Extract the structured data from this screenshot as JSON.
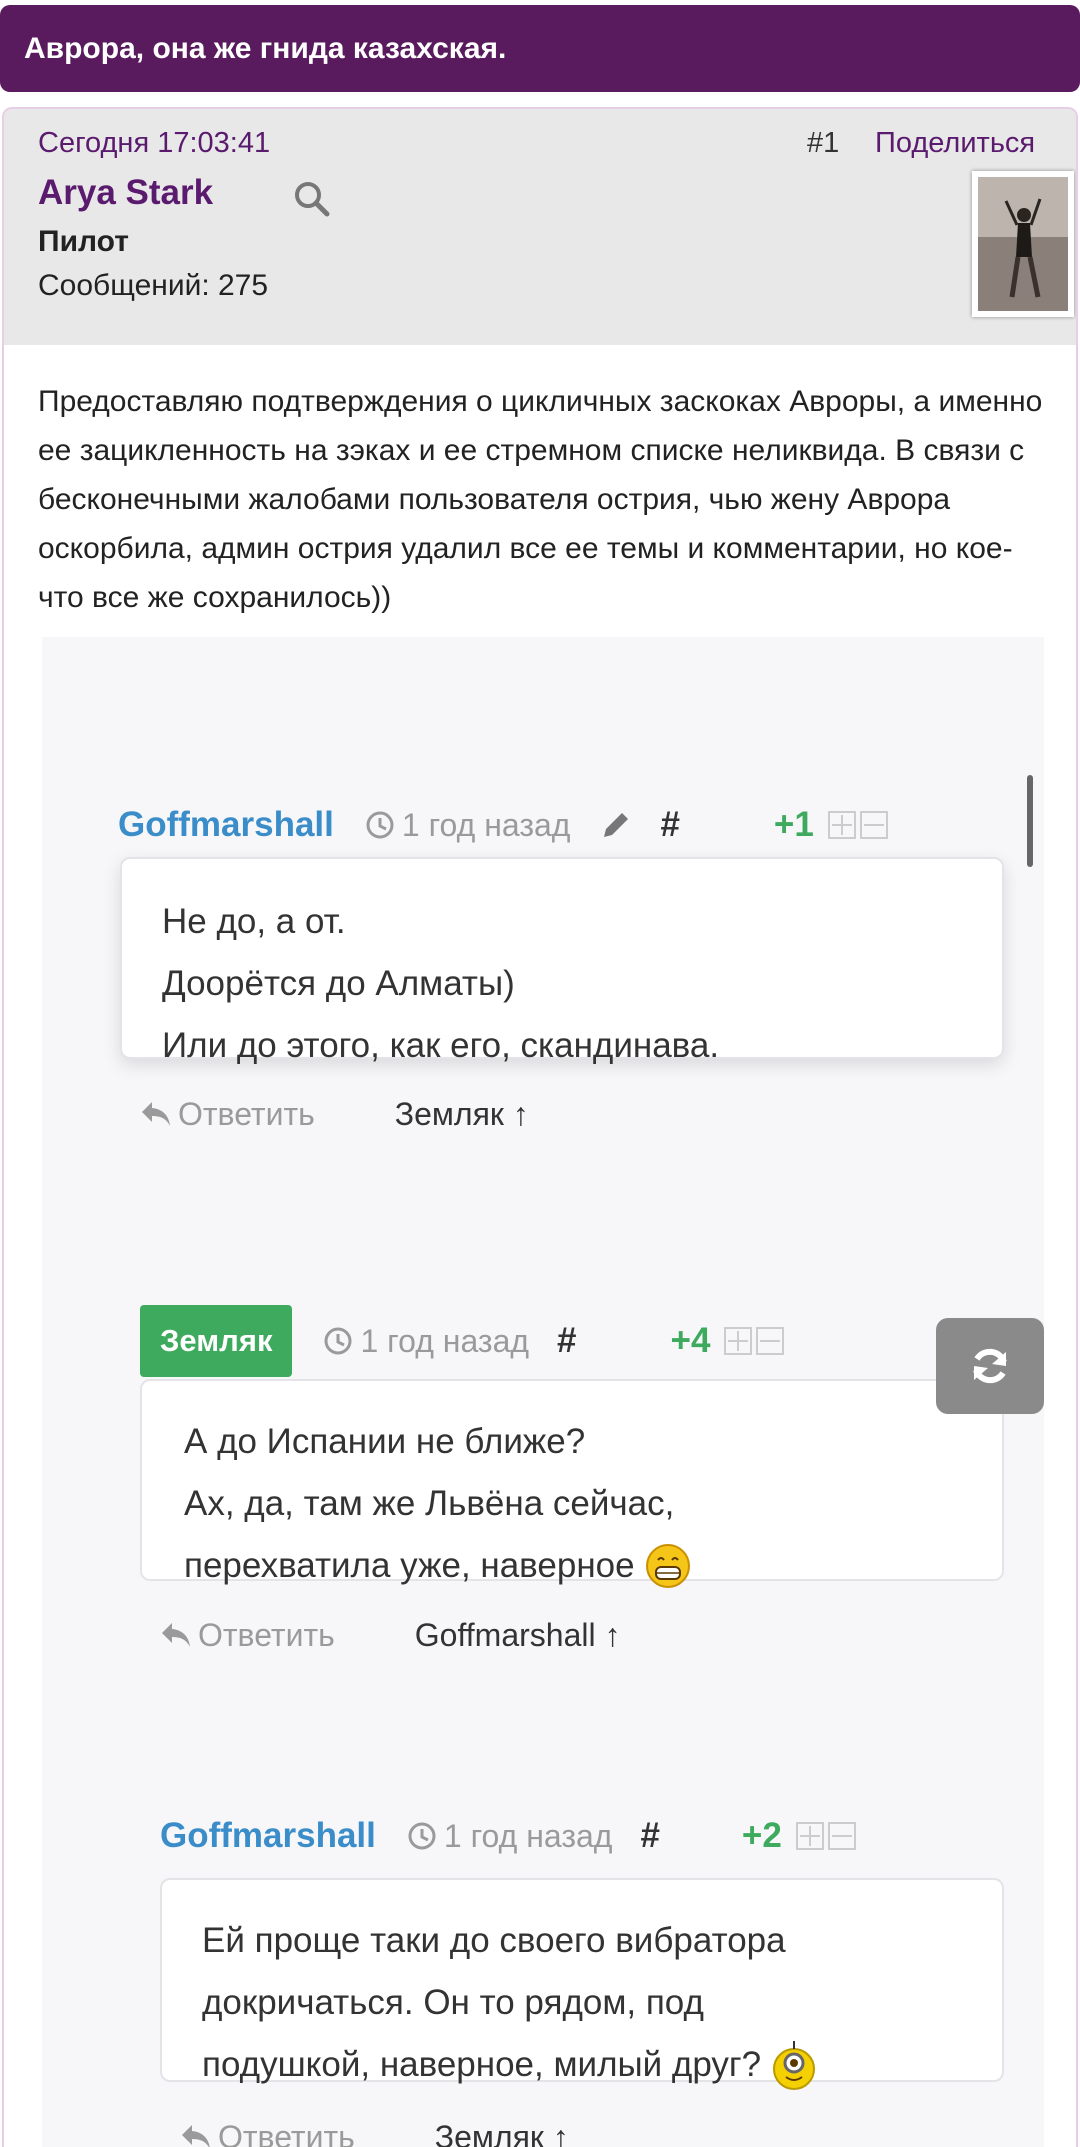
{
  "topic": {
    "title": "Аврора, она же гнида казахская."
  },
  "post": {
    "date": "Сегодня 17:03:41",
    "number": "#1",
    "share_label": "Поделиться",
    "author": {
      "name": "Arya Stark",
      "rank": "Пилот",
      "messages": "Сообщений: 275"
    },
    "text": "Предоставляю подтверждения о цикличных заскоках Авроры, а именно ее зацикленность на зэках и ее стремном списке неликвида. В связи с бесконечными жалобами пользователя острия, чью жену Аврора оскорбила, админ острия удалил все ее темы и комментарии, но кое-что все же сохранилось))"
  },
  "embedded_comments": [
    {
      "user": "Goffmarshall",
      "time": "1 год назад",
      "hash": "#",
      "votes": "+1",
      "lines": [
        "Не до, а от.",
        "Доорётся до Алматы)",
        "Или до этого, как его, скандинава."
      ],
      "reply_label": "Ответить",
      "parent": "Земляк ↑"
    },
    {
      "user": "Земляк",
      "time": "1 год назад",
      "hash": "#",
      "votes": "+4",
      "lines": [
        "А до Испании не ближе?",
        "Ах, да, там же Львёна сейчас,",
        "перехватила уже, наверное"
      ],
      "reply_label": "Ответить",
      "parent": "Goffmarshall ↑"
    },
    {
      "user": "Goffmarshall",
      "time": "1 год назад",
      "hash": "#",
      "votes": "+2",
      "lines": [
        "Ей проще таки до своего вибратора",
        "докричаться. Он то рядом, под",
        "подушкой, наверное, милый друг?"
      ],
      "reply_label": "Ответить",
      "parent": "Земляк ↑"
    }
  ],
  "icons": {
    "search": "search-icon",
    "history": "history-icon",
    "edit": "pencil-icon",
    "reply": "reply-arrow-icon",
    "expand": "expand-plus-icon",
    "collapse": "collapse-minus-icon",
    "refresh": "refresh-icon",
    "grin": "grin-emoji-icon",
    "minion": "minion-emoji-icon"
  },
  "colors": {
    "header_bg": "#5a1a5e",
    "author_purple": "#5a1a6e",
    "comment_user_blue": "#3a8dc9",
    "vote_green": "#3daa5d",
    "muted_gray": "#9a9a9a"
  }
}
